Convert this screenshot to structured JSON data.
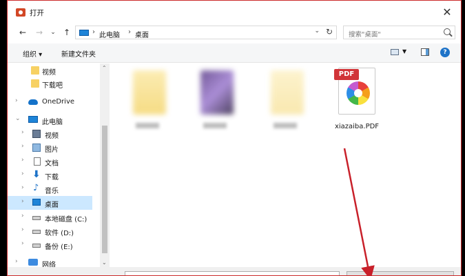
{
  "window": {
    "title": "打开"
  },
  "nav": {
    "back": "←",
    "forward": "→",
    "recent": "⌄",
    "up": "↑"
  },
  "address": {
    "crumbs": [
      "此电脑",
      "桌面"
    ],
    "separator": "›",
    "dropdown": "⌄",
    "refresh": "↻"
  },
  "search": {
    "placeholder": "搜索\"桌面\""
  },
  "toolbar": {
    "organize_label": "组织 ▾",
    "new_folder_label": "新建文件夹",
    "help": "?"
  },
  "sidebar": {
    "items": [
      {
        "label": "视频",
        "icon": "folder-icon",
        "chevron": ""
      },
      {
        "label": "下载吧",
        "icon": "folder-icon",
        "chevron": ""
      },
      {
        "label": "OneDrive",
        "icon": "onedrive-icon",
        "chevron": "›"
      },
      {
        "label": "此电脑",
        "icon": "monitor-icon",
        "chevron": "⌄"
      },
      {
        "label": "视频",
        "icon": "video-icon",
        "chevron": "›"
      },
      {
        "label": "图片",
        "icon": "picture-icon",
        "chevron": "›"
      },
      {
        "label": "文档",
        "icon": "document-icon",
        "chevron": "›"
      },
      {
        "label": "下载",
        "icon": "download-icon",
        "chevron": "›"
      },
      {
        "label": "音乐",
        "icon": "music-icon",
        "chevron": "›"
      },
      {
        "label": "桌面",
        "icon": "desktop-icon",
        "chevron": "›",
        "selected": true
      },
      {
        "label": "本地磁盘 (C:)",
        "icon": "drive-icon",
        "chevron": "›"
      },
      {
        "label": "软件 (D:)",
        "icon": "drive-icon",
        "chevron": "›"
      },
      {
        "label": "备份 (E:)",
        "icon": "drive-icon",
        "chevron": "›"
      },
      {
        "label": "网络",
        "icon": "network-icon",
        "chevron": "›"
      }
    ]
  },
  "scroll": {
    "up": "⌃",
    "down": "⌄"
  },
  "files": [
    {
      "name": "",
      "type": "folder",
      "blurred": true
    },
    {
      "name": "",
      "type": "folder",
      "blurred": true
    },
    {
      "name": "",
      "type": "folder",
      "blurred": true
    },
    {
      "name": "xiazaiba.PDF",
      "type": "pdf",
      "badge": "PDF"
    }
  ],
  "colors": {
    "selection": "#cce8ff",
    "annotation_arrow": "#c8202a",
    "pdf_badge": "#d13438",
    "accent": "#1e73c8"
  }
}
